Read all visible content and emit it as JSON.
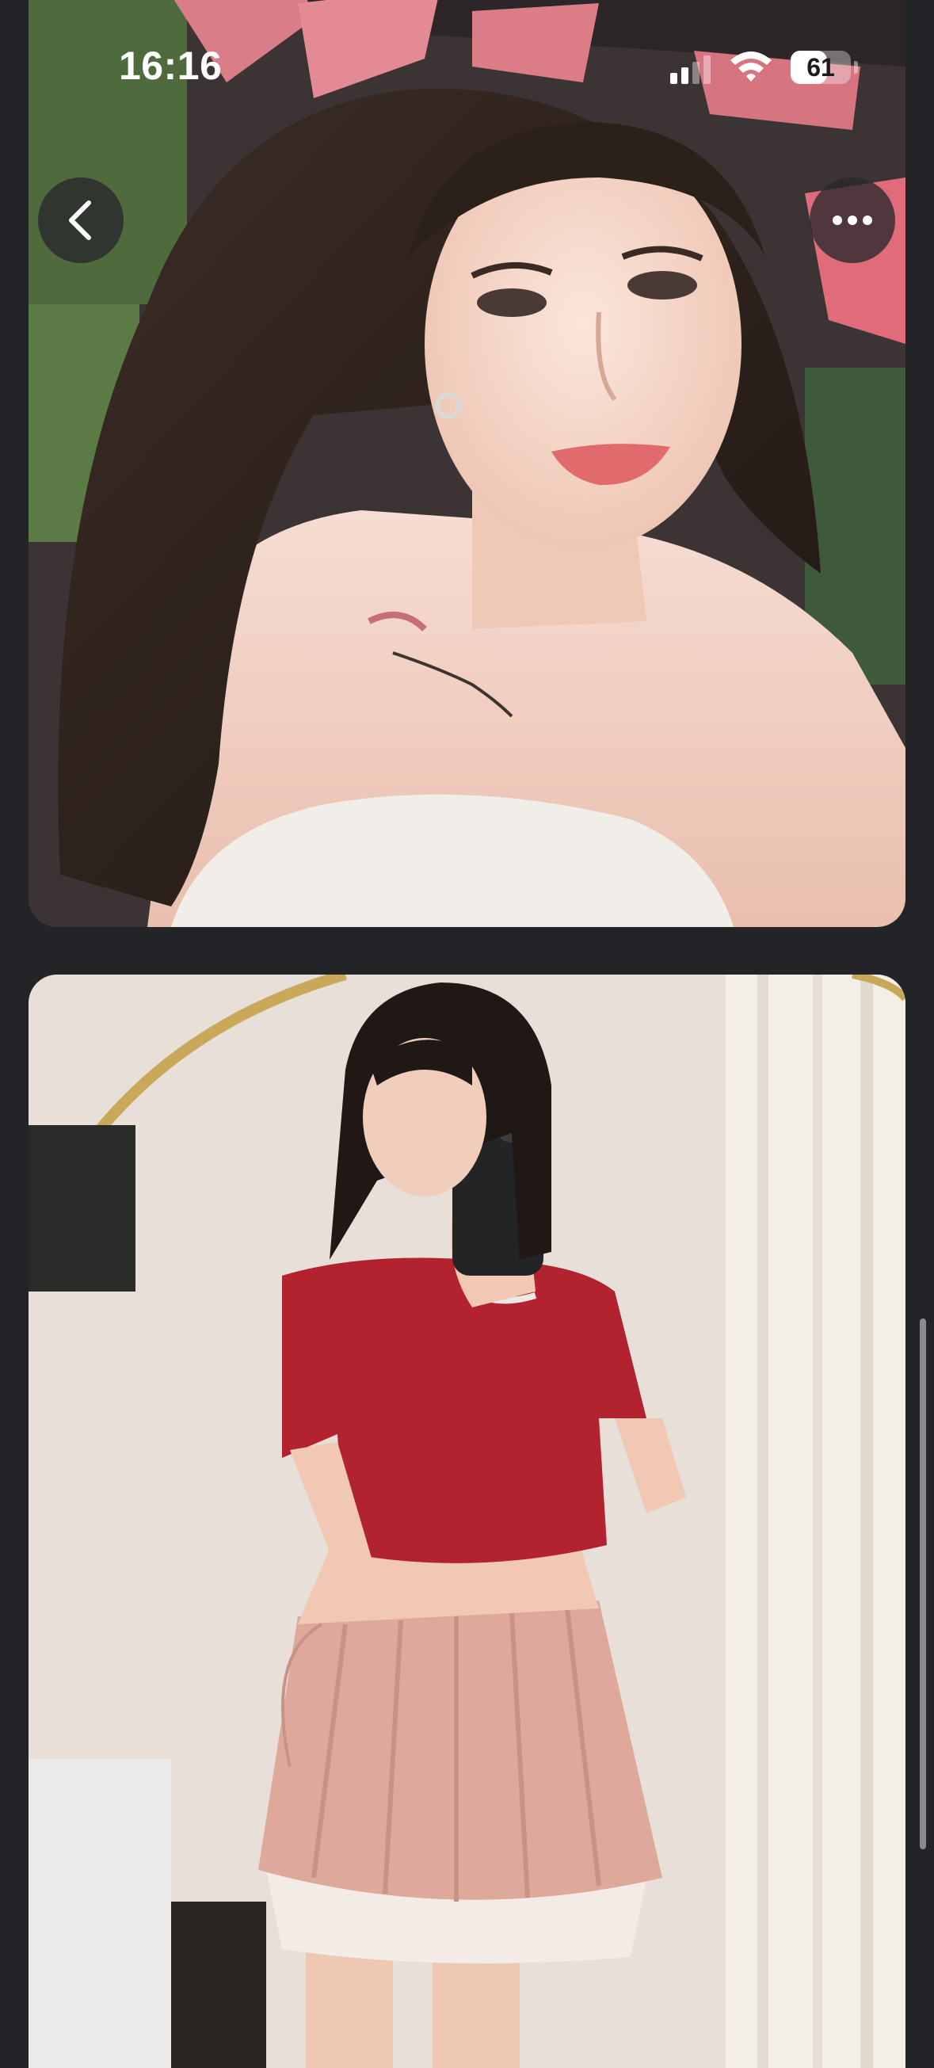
{
  "status_bar": {
    "time": "16:16",
    "battery_level": "61",
    "battery_fraction": 0.61,
    "signal_icon": "cellular-signal-icon",
    "wifi_icon": "wifi-icon"
  },
  "toolbar": {
    "back_icon": "chevron-left-icon",
    "more_icon": "ellipsis-icon"
  },
  "photos": [
    {
      "description_icon": "selfie-photo"
    },
    {
      "description_icon": "mirror-selfie-photo"
    }
  ],
  "scroll": {
    "position_fraction": 0.62
  },
  "colors": {
    "background": "#232427",
    "status_text": "#ffffff",
    "button_bg": "#28282c"
  }
}
